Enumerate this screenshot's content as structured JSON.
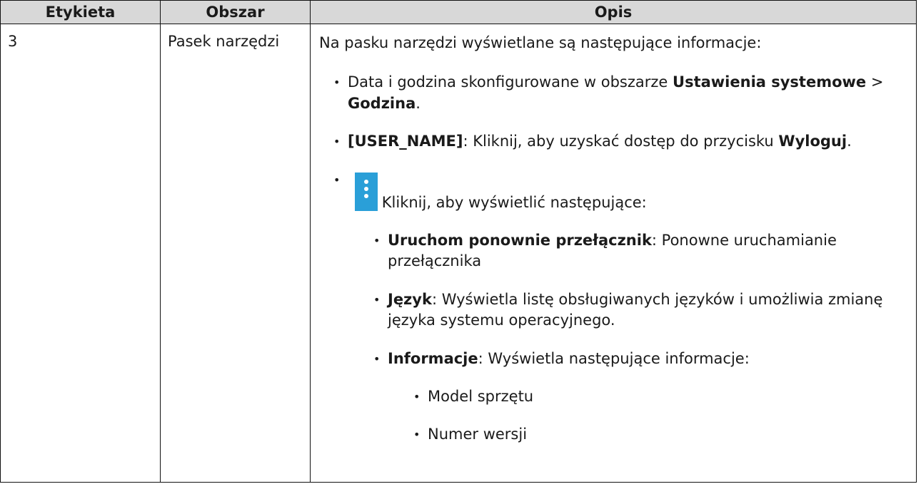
{
  "table": {
    "headers": [
      "Etykieta",
      "Obszar",
      "Opis"
    ],
    "row": {
      "label": "3",
      "area": "Pasek narzędzi",
      "intro": "Na pasku narzędzi wyświetlane są następujące informacje:",
      "items": {
        "datetime": {
          "text": "Data i godzina skonfigurowane w obszarze ",
          "bold1": "Ustawienia systemowe",
          "sep": " > ",
          "bold2": "Godzina",
          "end": "."
        },
        "user": {
          "bold": "[USER_NAME]",
          "text": ": Kliknij, aby uzyskać dostęp do przycisku ",
          "bold2": "Wyloguj",
          "end": "."
        },
        "menu": {
          "icon": "more-vertical-icon",
          "icon_color": "#2a9fd8",
          "text": ": Kliknij, aby wyświetlić następujące:",
          "subitems": {
            "restart": {
              "bold": "Uruchom ponownie przełącznik",
              "text": ": Ponowne uruchamianie przełącznika"
            },
            "language": {
              "bold": "Język",
              "text": ": Wyświetla listę obsługiwanych języków i umożliwia zmianę języka systemu operacyjnego."
            },
            "info": {
              "bold": "Informacje",
              "text": ": Wyświetla następujące informacje:",
              "details": [
                "Model sprzętu",
                "Numer wersji"
              ]
            }
          }
        }
      }
    }
  },
  "colors": {
    "header_bg": "#d8d8d8",
    "border": "#111111",
    "accent": "#2a9fd8"
  }
}
